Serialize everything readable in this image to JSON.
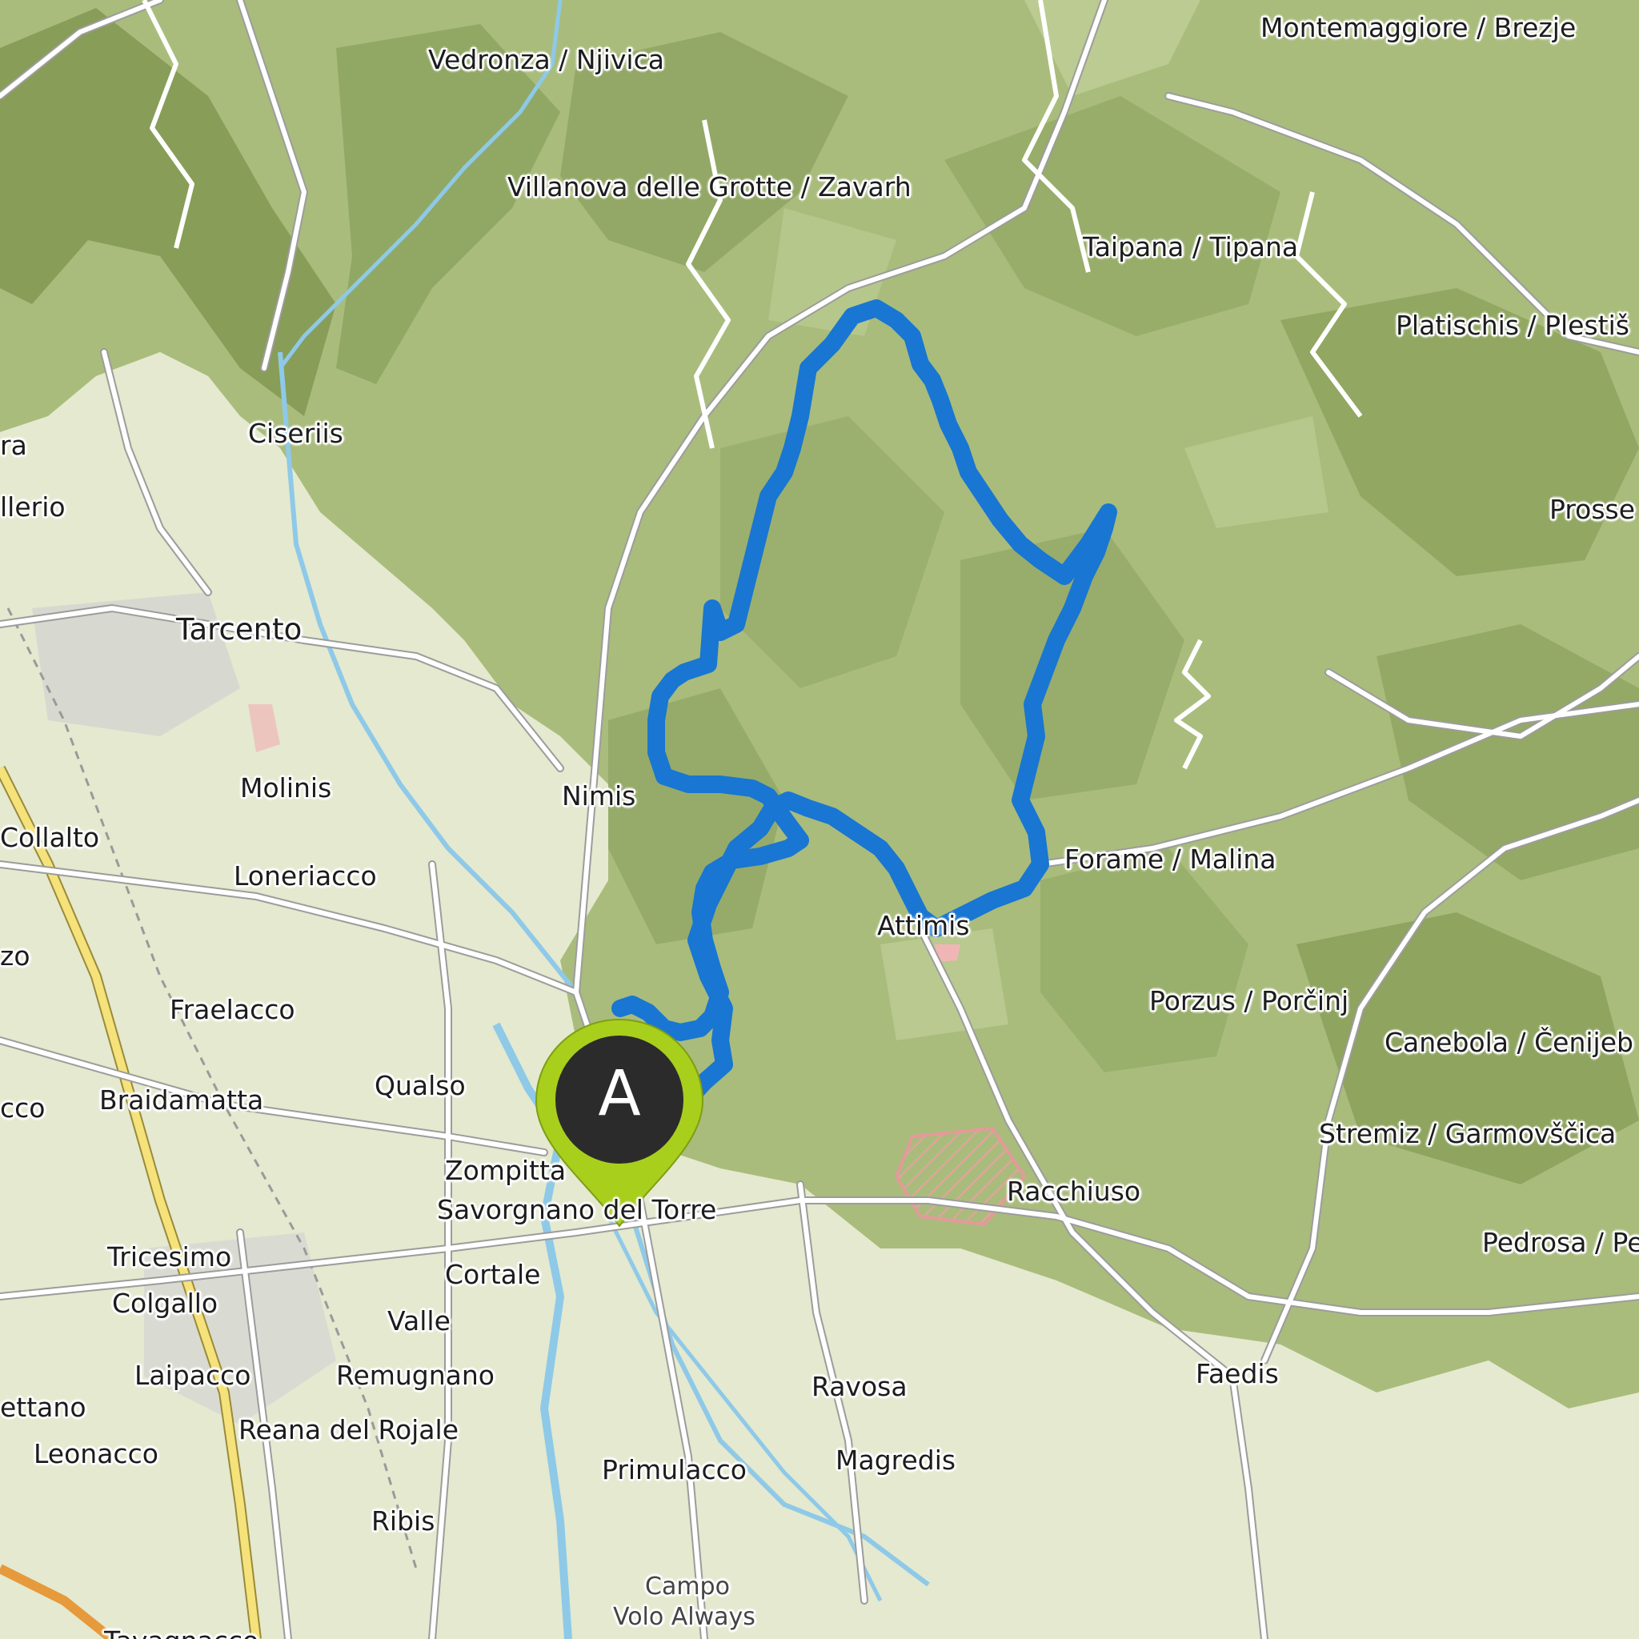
{
  "map": {
    "route_color": "#1976d2",
    "start_marker": {
      "letter": "A",
      "ring_color": "#a8cf1c",
      "fill_color": "#2b2b2b"
    },
    "places": {
      "vedronza": "Vedronza / Njivica",
      "montemaggiore": "Montemaggiore / Brezje",
      "villanova": "Villanova delle Grotte / Zavarh",
      "taipana": "Taipana / Tipana",
      "platischis": "Platischis / Plestiš",
      "ciseriis": "Ciseriis",
      "lerio": "llerio",
      "ra": "ra",
      "tarcento": "Tarcento",
      "prosse": "Prosse",
      "molinis": "Molinis",
      "nimis": "Nimis",
      "collalto": "Collalto",
      "loneriacco": "Loneriacco",
      "forame": "Forame / Malina",
      "attimis": "Attimis",
      "zo": "zo",
      "fraelacco": "Fraelacco",
      "porzus": "Porzus / Porčinj",
      "canebola": "Canebola / Čenijeb",
      "cco": "cco",
      "braidamatta": "Braidamatta",
      "qualso": "Qualso",
      "stremiz": "Stremiz / Garmovščica",
      "zompitta": "Zompitta",
      "racchiuso": "Racchiuso",
      "savorgnano": "Savorgnano del Torre",
      "pedrosa": "Pedrosa / Pe",
      "tricesimo": "Tricesimo",
      "cortale": "Cortale",
      "colgallo": "Colgallo",
      "valle": "Valle",
      "faedis": "Faedis",
      "laipacco": "Laipacco",
      "remugnano": "Remugnano",
      "ravosa": "Ravosa",
      "ettano": "ettano",
      "reana": "Reana del Rojale",
      "leonacco": "Leonacco",
      "magredis": "Magredis",
      "primulacco": "Primulacco",
      "ribis": "Ribis",
      "campo": "Campo",
      "volo": "Volo Always",
      "tavagnacco": "Tavagnacco"
    }
  }
}
